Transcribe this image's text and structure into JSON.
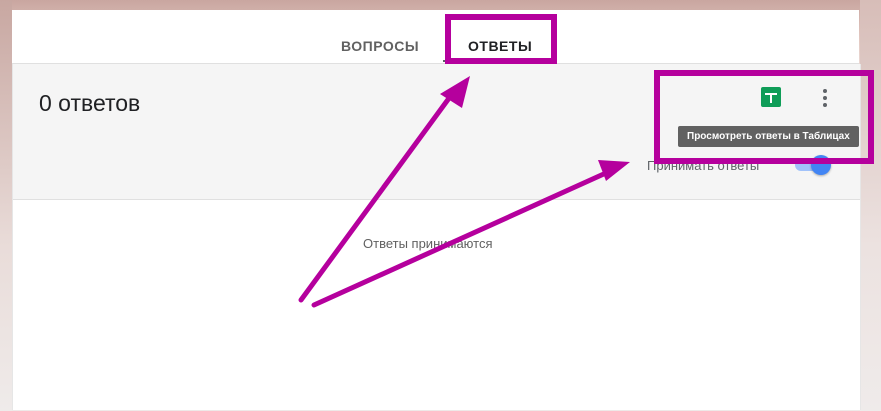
{
  "tabs": [
    {
      "label": "ВОПРОСЫ"
    },
    {
      "label": "ОТВЕТЫ"
    }
  ],
  "responses": {
    "count_text": "0 ответов",
    "sheets_tooltip": "Просмотреть ответы в Таблицах",
    "accepting_label": "Принимать ответы",
    "accepting_enabled": true,
    "status_text": "Ответы принимаются"
  },
  "icons": {
    "sheets": "google-sheets-icon",
    "more": "more-vert-icon"
  },
  "colors": {
    "annotation": "#b5009d",
    "sheets_green": "#0f9d58",
    "toggle_blue": "#4285f4"
  }
}
